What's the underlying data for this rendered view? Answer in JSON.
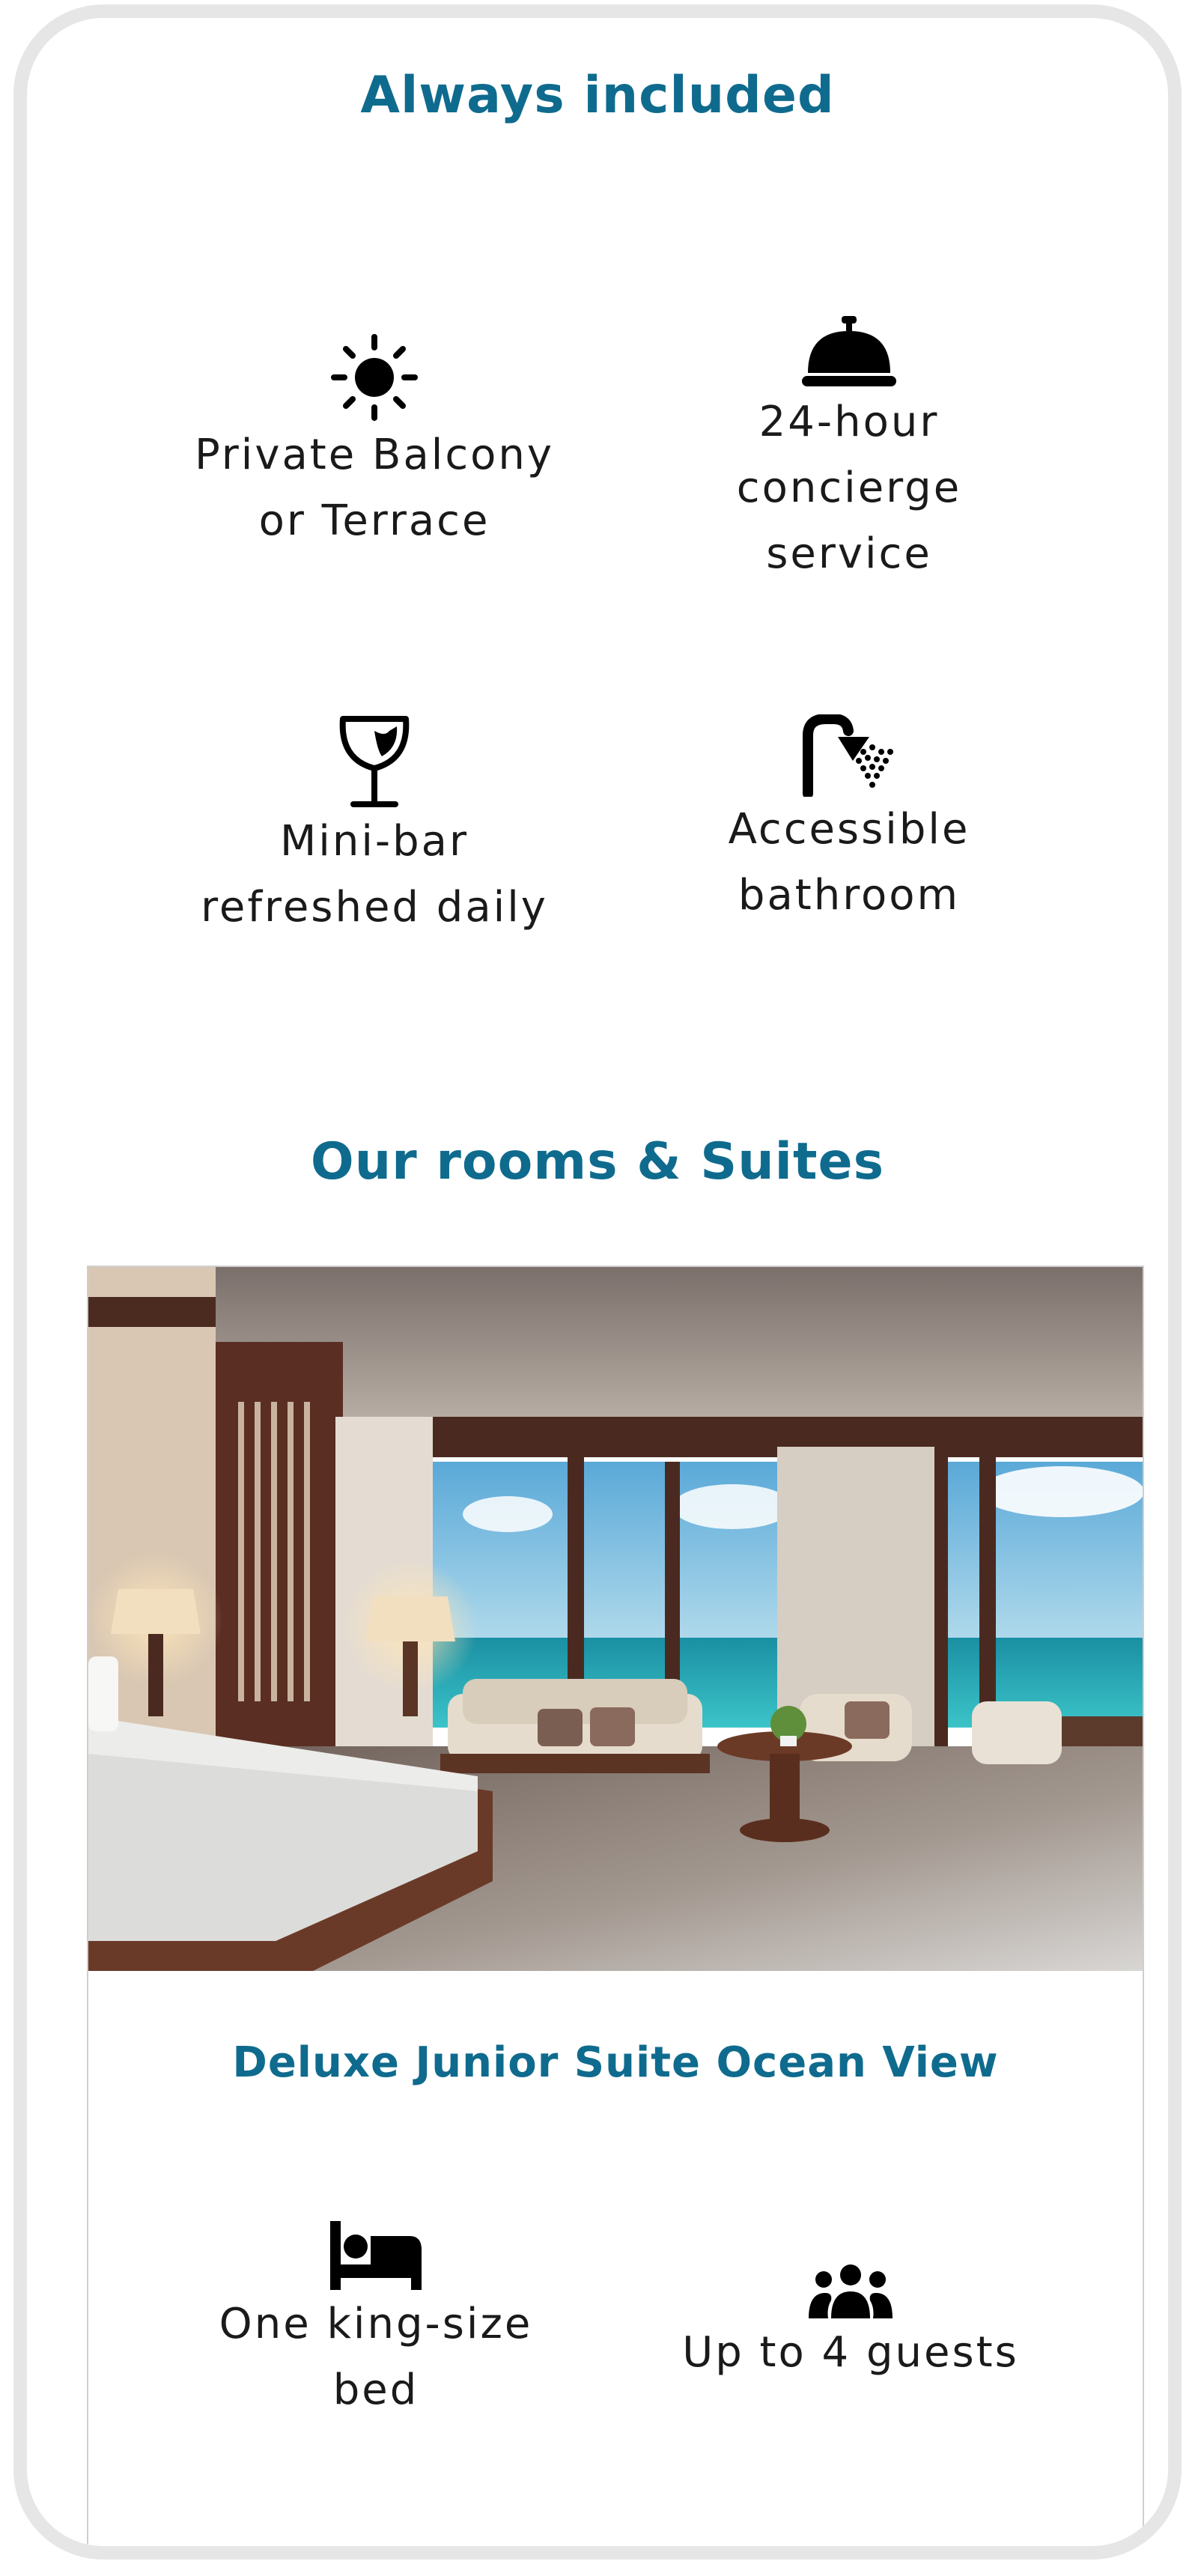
{
  "always_included": {
    "title": "Always included",
    "items": [
      {
        "icon": "sun-icon",
        "label": "Private Balcony\nor Terrace"
      },
      {
        "icon": "service-bell-icon",
        "label": "24-hour\nconcierge\nservice"
      },
      {
        "icon": "wine-glass-icon",
        "label": "Mini-bar\nrefreshed daily"
      },
      {
        "icon": "shower-icon",
        "label": "Accessible\nbathroom"
      }
    ]
  },
  "rooms": {
    "title": "Our rooms & Suites",
    "cards": [
      {
        "image": "ocean-view-suite-photo",
        "name": "Deluxe Junior Suite Ocean View",
        "features": [
          {
            "icon": "bed-icon",
            "label": "One king-size\nbed"
          },
          {
            "icon": "users-icon",
            "label": "Up to 4 guests"
          }
        ]
      }
    ]
  },
  "colors": {
    "accent": "#0f6b8e",
    "text": "#1a1a1a",
    "frame": "#e6e6e6",
    "sea": "#2bb8c4"
  }
}
